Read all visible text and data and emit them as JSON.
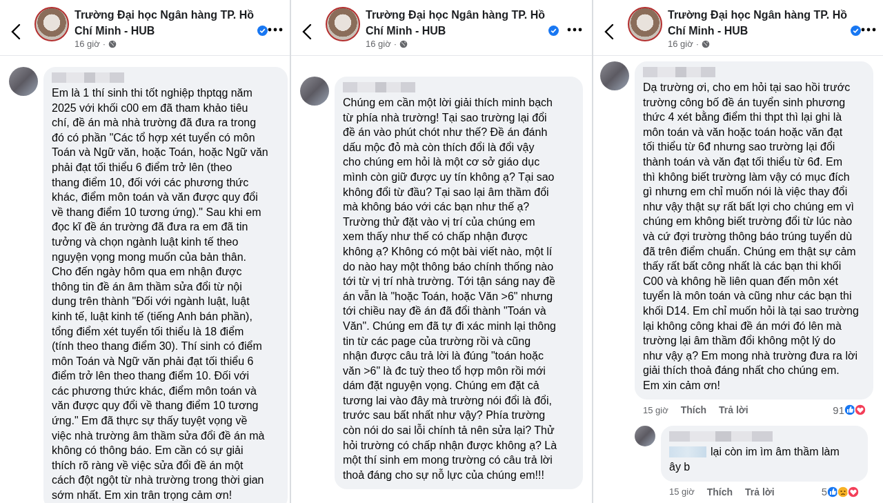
{
  "panels": [
    {
      "page_name": "Trường Đại học Ngân hàng TP. Hồ\nChí Minh - HUB",
      "verified": true,
      "time": "16 giờ",
      "separator": "·",
      "comment": {
        "text": "Em là 1 thí sinh thi tốt nghiệp thptqg năm\n2025 với khối c00 em đã tham khảo tiêu\nchí, đề án mà nhà trường đã đưa ra trong\nđó có phần \"Các tổ hợp xét tuyển có môn\nToán và Ngữ văn, hoặc Toán, hoặc Ngữ văn\nphải đạt tối thiểu 6 điểm trở lên (theo\nthang điểm 10, đối với các phương thức\nkhác, điểm môn toán và văn được quy đổi\nvề thang điểm 10 tương ứng).\" Sau khi em\nđọc kĩ đề án trường đã đưa ra em đã tin\ntưởng và chọn ngành luật kinh tế theo\nnguyện vọng mong muốn của bản thân.\nCho đến ngày hôm qua em nhận được\nthông tin đề án âm thầm sửa đổi từ nội\ndung trên thành \"Đối với ngành luật, luật\nkinh tế, luật kinh tế (tiếng Anh bán phần),\ntổng điểm xét tuyển tối thiểu là 18 điểm\n(tính theo thang điểm 30). Thí sinh có điểm\nmôn Toán và Ngữ văn phải đạt tối thiểu 6\nđiểm trở lên theo thang điểm 10. Đối với\ncác phương thức khác, điểm môn toán và\nvăn được quy đổi về thang điểm 10 tương\nứng.\" Em đã thực sự thấy tuyệt vọng về\nviệc nhà trường âm thầm sửa đổi đề án mà\nkhông có thông báo. Em cần có sự giải\nthích rõ ràng về việc sửa đổi đề án một\ncách đột ngột từ nhà trường trong thời gian\nsớm nhất. Em xin trân trọng cảm ơn!"
      }
    },
    {
      "page_name": "Trường Đại học Ngân hàng TP. Hồ\nChí Minh - HUB",
      "verified": true,
      "time": "16 giờ",
      "separator": "·",
      "comment": {
        "text": "Chúng em cần một lời giải thích minh bạch\ntừ phía nhà trường! Tại sao trường lại đổi\nđề án vào phút chót như thế? Đề án đánh\ndấu mộc đỏ mà còn thích đổi là đổi vậy\ncho chúng em hỏi là một cơ sở giáo dục\nmình còn giữ được uy tín không ạ? Tại sao\nkhông đổi từ đầu? Tại sao lại âm thầm đổi\nmà không báo với các bạn như thế ạ?\nTrường thử đặt vào vị trí của chúng em\nxem thấy như thế có chấp nhận được\nkhông ạ? Không có một bài viết nào, một lí\ndo nào hay một thông báo chính thống nào\ntới từ vị trí nhà trường. Tới tận sáng nay đề\nán vẫn là \"hoặc Toán, hoặc Văn >6\" nhưng\ntới chiều nay đề án đã đổi thành \"Toán và\nVăn\". Chúng em đã tự đi xác minh lại thông\ntin từ các page của trường rồi và cũng\nnhận được câu trả lời là đúng \"toán hoặc\nvăn >6\" là đc tuỳ theo tổ hợp môn rồi mới\ndám đặt nguyện vọng. Chúng em đặt cả\ntương lai vào đây mà trường nói đổi là đổi,\ntrước sau bất nhất như vậy? Phía trường\ncòn nói do sai lỗi chính tả nên sửa lại? Thử\nhỏi trường có chấp nhận được không ạ? Là\nmột thí sinh em mong trường có câu trả lời\nthoả đáng cho sự nỗ lực của chúng em!!!"
      }
    },
    {
      "page_name": "Trường Đại học Ngân hàng TP. Hồ\nChí Minh - HUB",
      "verified": true,
      "time": "16 giờ",
      "separator": "·",
      "comment": {
        "text": "Dạ trường ơi, cho em hỏi tại sao hồi trước\ntrường công bố đề án tuyển sinh phương\nthức 4 xét bằng điểm thi thpt thì lại ghi là\nmôn toán và văn hoặc toán hoặc văn đạt\ntối thiểu từ 6đ nhưng sao trường lại đổi\nthành toán và văn đạt tối thiểu từ 6đ. Em\nthì không biết trường làm vậy có mục đích\ngì nhưng em chỉ muốn nói là việc thay đổi\nnhư vậy thật sự rất bất lợi cho chúng em vì\nchúng em không biết trường đổi từ lúc nào\nvà cứ đợi trường thông báo trúng tuyển dù\nđã trên điểm chuẩn. Chúng em thật sự cảm\nthấy rất bất công nhất là các bạn thi khối\nC00 và không hề liên quan đến môn xét\ntuyển là môn toán và cũng như các bạn thi\nkhối D14. Em chỉ muốn hỏi là tại sao trường\nlại không công khai đề án mới đó lên mà\ntrường lại âm thầm đổi không một lý do\nnhư vậy ạ? Em mong nhà trường đưa ra lời\ngiải thích thoả đáng nhất cho chúng em.\nEm xin cảm ơn!",
        "footer": {
          "time": "15 giờ",
          "like": "Thích",
          "reply": "Trả lời",
          "count": "91",
          "reactions": [
            {
              "kind": "like"
            },
            {
              "kind": "love"
            }
          ]
        },
        "replies": [
          {
            "lines": [
              "lại còn im ìm âm thầm làm",
              "ây b"
            ],
            "footer": {
              "time": "15 giờ",
              "like": "Thích",
              "reply": "Trả lời",
              "count": "5",
              "reactions": [
                {
                  "kind": "like"
                },
                {
                  "kind": "sad"
                },
                {
                  "kind": "love"
                }
              ]
            }
          }
        ]
      }
    }
  ]
}
